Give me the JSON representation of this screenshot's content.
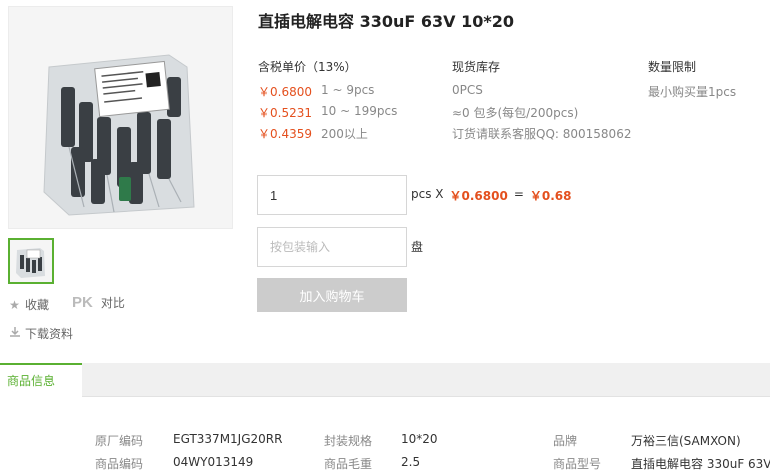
{
  "product": {
    "title": "直插电解电容 330uF 63V 10*20",
    "image_alt": "capacitor bag photo"
  },
  "sidebar": {
    "favorite_label": "收藏",
    "pk_label": "PK",
    "compare_label": "对比",
    "download_label": "下载资料"
  },
  "pricing": {
    "header": "含税单价（13%）",
    "tiers": [
      {
        "price": "￥0.6800",
        "qty": "1 ~ 9pcs"
      },
      {
        "price": "￥0.5231",
        "qty": "10 ~ 199pcs"
      },
      {
        "price": "￥0.4359",
        "qty": "200以上"
      }
    ]
  },
  "stock": {
    "header": "现货库存",
    "qty": "0PCS",
    "pack": "≈0 包多(每包/200pcs)",
    "contact": "订货请联系客服QQ: 800158062"
  },
  "limit": {
    "header": "数量限制",
    "min": "最小购买量1pcs"
  },
  "order": {
    "quantity_value": "1",
    "unit_x": "pcs X",
    "unit_price": "￥0.6800",
    "equals": "=",
    "total": "￥0.68",
    "package_placeholder": "按包装输入",
    "package_unit": "盘",
    "add_to_cart": "加入购物车"
  },
  "info": {
    "tab_label": "商品信息",
    "specs": [
      {
        "label": "原厂编码",
        "value": "EGT337M1JG20RR"
      },
      {
        "label": "封装规格",
        "value": "10*20"
      },
      {
        "label": "品牌",
        "value": "万裕三信(SAMXON)"
      },
      {
        "label": "商品编码",
        "value": "04WY013149"
      },
      {
        "label": "商品毛重",
        "value": "2.5"
      },
      {
        "label": "商品型号",
        "value": "直插电解电容 330uF 63V ..."
      }
    ]
  },
  "colors": {
    "accent": "#5ab031",
    "price": "#e4501e",
    "disabled_button": "#cccccc"
  }
}
